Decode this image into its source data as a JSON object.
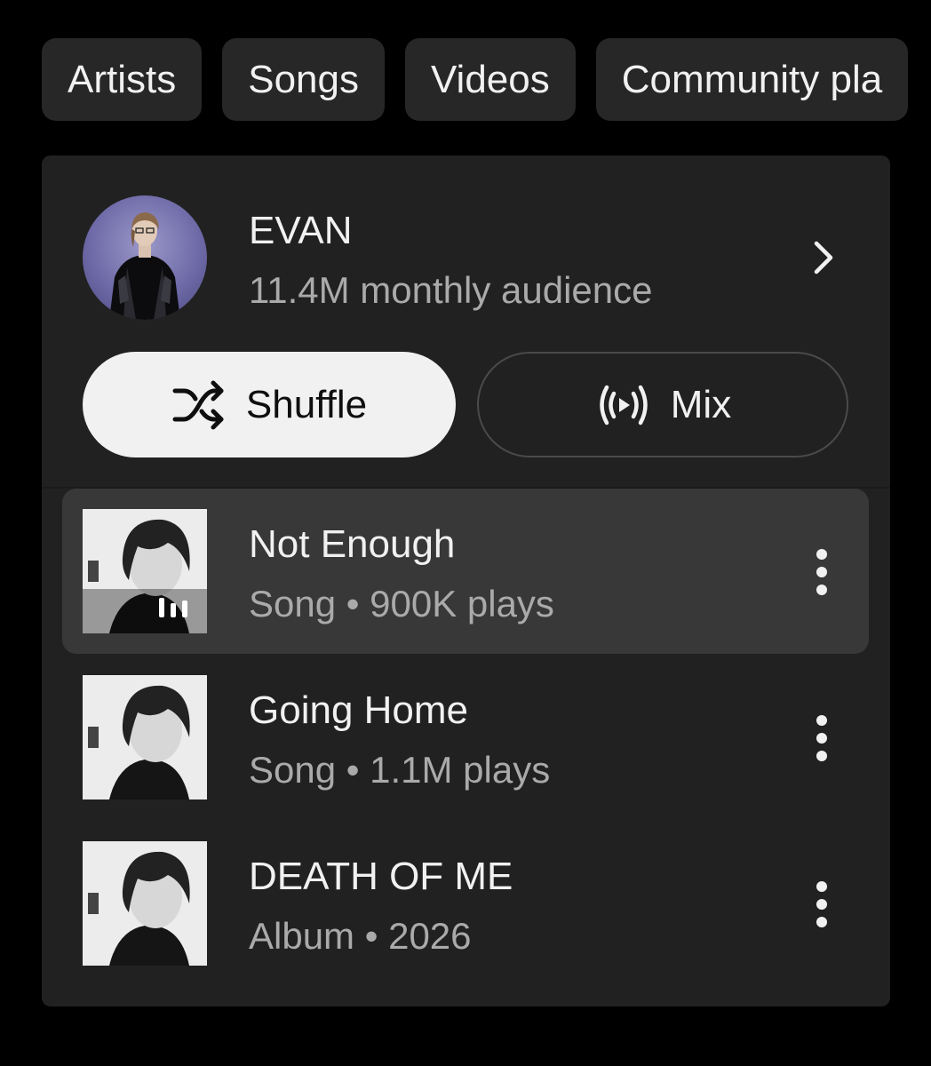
{
  "chips": [
    "Artists",
    "Songs",
    "Videos",
    "Community pla"
  ],
  "artist": {
    "name": "EVAN",
    "subtitle": "11.4M monthly audience",
    "avatar_icon": "artist-portrait",
    "chevron_icon": "chevron-right-icon"
  },
  "actions": {
    "shuffle_label": "Shuffle",
    "shuffle_icon": "shuffle-icon",
    "mix_label": "Mix",
    "mix_icon": "radio-broadcast-icon"
  },
  "results": [
    {
      "title": "Not Enough",
      "subtitle": "Song • 900K plays",
      "playing": true
    },
    {
      "title": "Going Home",
      "subtitle": "Song • 1.1M plays",
      "playing": false
    },
    {
      "title": "DEATH OF ME",
      "subtitle": "Album • 2026",
      "playing": false
    }
  ],
  "colors": {
    "background": "#000000",
    "card": "#212121",
    "chip": "#272727",
    "active_row": "#383838",
    "primary_text": "#f1f1f1",
    "secondary_text": "#aaaaaa",
    "shuffle_button": "#f1f1f1"
  }
}
